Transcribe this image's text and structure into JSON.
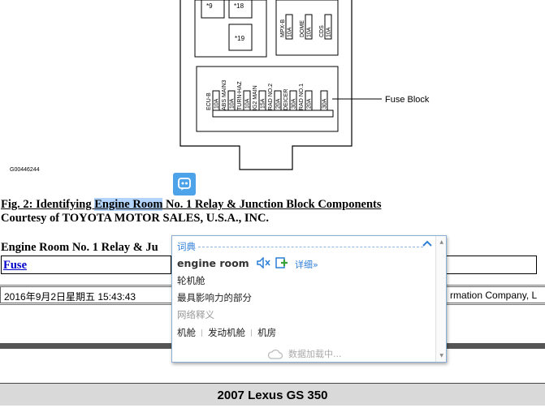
{
  "diagram": {
    "relays_top": [
      "*9",
      "*18",
      "*19"
    ],
    "fuse_block_label": "Fuse Block",
    "diagram_id": "G00446244",
    "lower_fuses": [
      {
        "name": "ECU-B",
        "amp": "10A"
      },
      {
        "name": "ABS MAIN3",
        "amp": "10A"
      },
      {
        "name": "TURN-HAZ",
        "amp": "10A"
      },
      {
        "name": "IG2 MAIN",
        "amp": "15A"
      },
      {
        "name": "RAD NO.2",
        "amp": "20A"
      },
      {
        "name": "DEICER",
        "amp": "30A"
      },
      {
        "name": "RAD NO.1",
        "amp": "20A"
      },
      {
        "name": "",
        "amp": "30A"
      }
    ],
    "upper_fuses": [
      {
        "name": "MPX-B",
        "amp": "10A"
      },
      {
        "name": "DOME",
        "amp": "10A"
      },
      {
        "name": "CDS",
        "amp": "10A"
      }
    ]
  },
  "caption": {
    "prefix": "Fig. 2: Identifying ",
    "highlight": "Engine Room",
    "suffix": " No. 1 Relay & Junction Block Components"
  },
  "courtesy": "Courtesy of TOYOTA MOTOR SALES, U.S.A., INC.",
  "section_heading": "Engine Room No. 1 Relay & Ju",
  "table": {
    "col1_header": "Fuse"
  },
  "status_bar": {
    "datetime": "2016年9月2日星期五  15:43:43",
    "right_text": "rmation Company, L"
  },
  "footer": {
    "title": "2007 Lexus GS 350"
  },
  "dictionary": {
    "header": "词典",
    "word": "engine room",
    "detail_link": "详细»",
    "definitions": [
      "轮机舱",
      "最具影响力的部分"
    ],
    "web_title": "网络释义",
    "web_terms": [
      "机舱",
      "发动机舱",
      "机房"
    ],
    "loading": "数据加载中..."
  },
  "colors": {
    "accent": "#2f7ed8",
    "selection": "#b3d4fc",
    "link": "#0000cc"
  },
  "icons": [
    "translate-icon",
    "speaker-mute-icon",
    "add-word-icon",
    "chevron-up-icon",
    "cloud-icon"
  ]
}
